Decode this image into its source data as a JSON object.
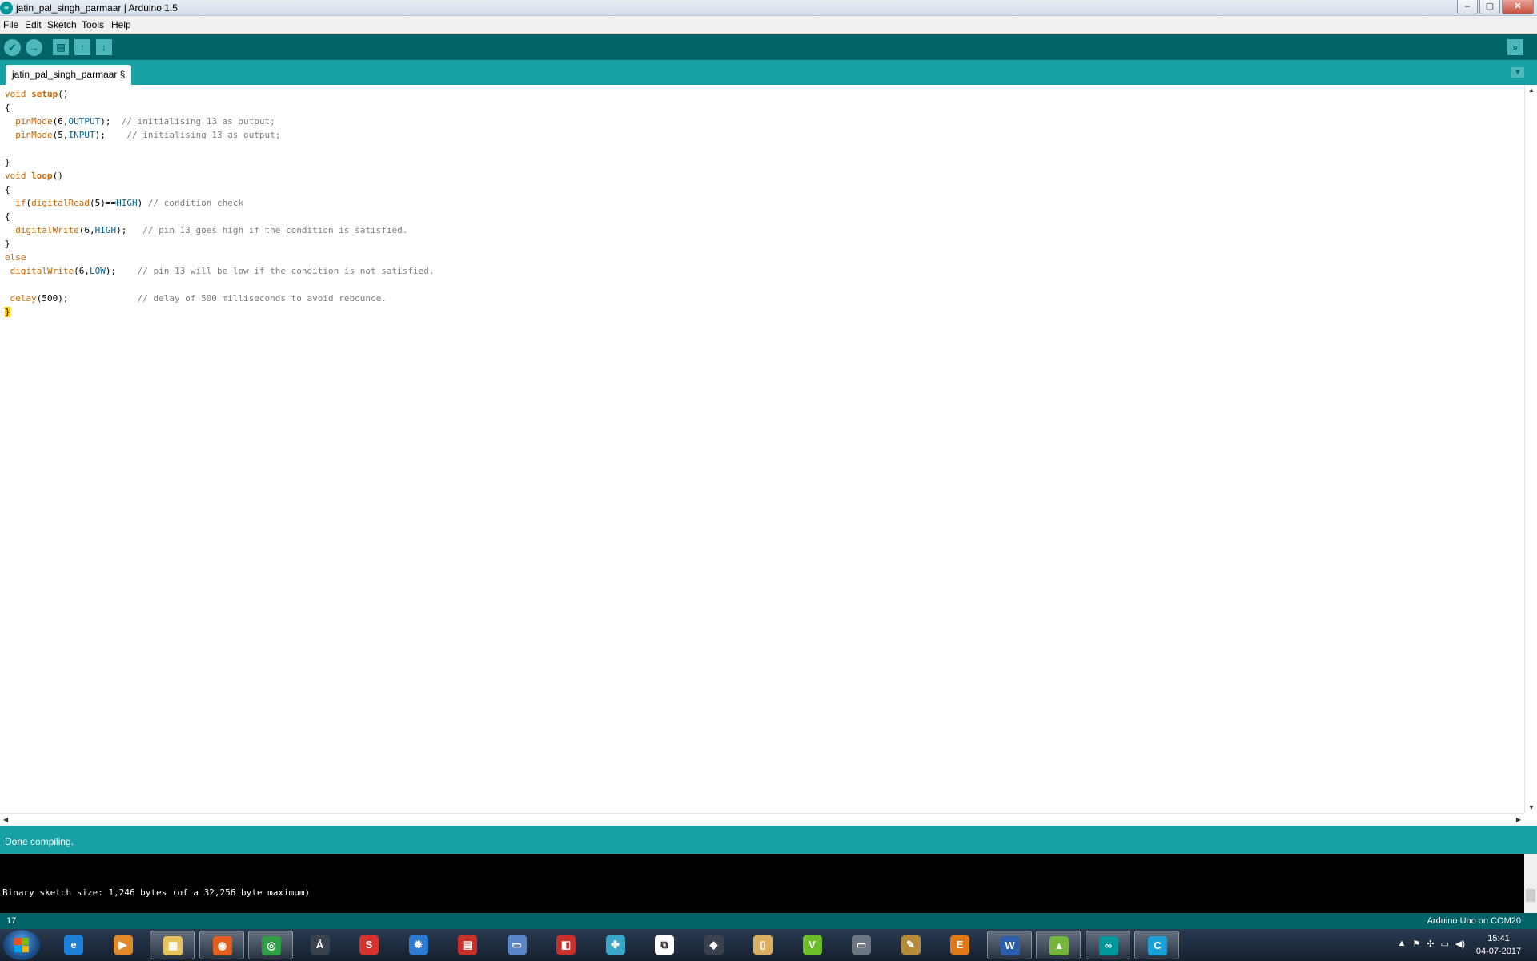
{
  "window": {
    "title": "jatin_pal_singh_parmaar | Arduino 1.5",
    "logo_text": "∞",
    "controls": {
      "minimize": "–",
      "maximize": "▢",
      "close": "✕"
    }
  },
  "menu": {
    "items": [
      "File",
      "Edit",
      "Sketch",
      "Tools",
      "Help"
    ]
  },
  "toolbar": {
    "verify_glyph": "✓",
    "upload_glyph": "→",
    "new_glyph": "▤",
    "open_glyph": "↑",
    "save_glyph": "↓",
    "serial_monitor_glyph": "⌕"
  },
  "tabs": [
    {
      "label": "jatin_pal_singh_parmaar §"
    }
  ],
  "tab_menu_glyph": "▼",
  "editor": {
    "lines": [
      "void setup()",
      "{",
      "  pinMode(6,OUTPUT);  // initialising 13 as output;",
      "  pinMode(5,INPUT);    // initialising 13 as output;",
      "",
      "}",
      "void loop()",
      "{",
      "  if(digitalRead(5)==HIGH) // condition check",
      "{",
      "  digitalWrite(6,HIGH);   // pin 13 goes high if the condition is satisfied.",
      "}",
      "else",
      " digitalWrite(6,LOW);    // pin 13 will be low if the condition is not satisfied.",
      "",
      " delay(500);             // delay of 500 milliseconds to avoid rebounce.",
      "}"
    ]
  },
  "status": {
    "message": "Done compiling."
  },
  "console": {
    "output": "Binary sketch size: 1,246 bytes (of a 32,256 byte maximum)"
  },
  "footer": {
    "line_number": "17",
    "board": "Arduino Uno on COM20"
  },
  "taskbar": {
    "apps": [
      {
        "name": "internet-explorer",
        "glyph": "e",
        "color": "#1e7fd6",
        "open": false
      },
      {
        "name": "media-player",
        "glyph": "▶",
        "color": "#e08a2a",
        "open": false
      },
      {
        "name": "file-explorer",
        "glyph": "▦",
        "color": "#e8c25a",
        "open": true
      },
      {
        "name": "firefox",
        "glyph": "◉",
        "color": "#e2601f",
        "open": true
      },
      {
        "name": "chrome",
        "glyph": "◎",
        "color": "#2f9e44",
        "open": true
      },
      {
        "name": "app-a",
        "glyph": "Å",
        "color": "#39424e",
        "open": false
      },
      {
        "name": "sketchup",
        "glyph": "S",
        "color": "#d6322e",
        "open": false
      },
      {
        "name": "app-gear",
        "glyph": "✹",
        "color": "#2a7bd1",
        "open": false
      },
      {
        "name": "app-red-doc",
        "glyph": "▤",
        "color": "#c9302c",
        "open": false
      },
      {
        "name": "app-monitor",
        "glyph": "▭",
        "color": "#5a86c8",
        "open": false
      },
      {
        "name": "app-red-box",
        "glyph": "◧",
        "color": "#c9302c",
        "open": false
      },
      {
        "name": "app-pinwheel",
        "glyph": "✤",
        "color": "#3aa7c9",
        "open": false
      },
      {
        "name": "app-white-box",
        "glyph": "⧉",
        "color": "#ffffff",
        "open": false
      },
      {
        "name": "app-diamond",
        "glyph": "◆",
        "color": "#39424e",
        "open": false
      },
      {
        "name": "app-doc-yellow",
        "glyph": "▯",
        "color": "#d9b062",
        "open": false
      },
      {
        "name": "app-v",
        "glyph": "V",
        "color": "#6cbf2a",
        "open": false
      },
      {
        "name": "app-presenter",
        "glyph": "▭",
        "color": "#6b7785",
        "open": false
      },
      {
        "name": "app-tool",
        "glyph": "✎",
        "color": "#b58a38",
        "open": false
      },
      {
        "name": "app-e",
        "glyph": "E",
        "color": "#e07a18",
        "open": false
      },
      {
        "name": "word",
        "glyph": "W",
        "color": "#2b5fad",
        "open": true
      },
      {
        "name": "app-chart",
        "glyph": "▲",
        "color": "#74b63a",
        "open": true
      },
      {
        "name": "arduino",
        "glyph": "∞",
        "color": "#00979c",
        "open": true
      },
      {
        "name": "app-c",
        "glyph": "C",
        "color": "#1aa0d8",
        "open": true
      }
    ],
    "tray": [
      "▲",
      "⚑",
      "✣",
      "▭",
      "◀)"
    ],
    "time": "15:41",
    "date": "04-07-2017"
  }
}
